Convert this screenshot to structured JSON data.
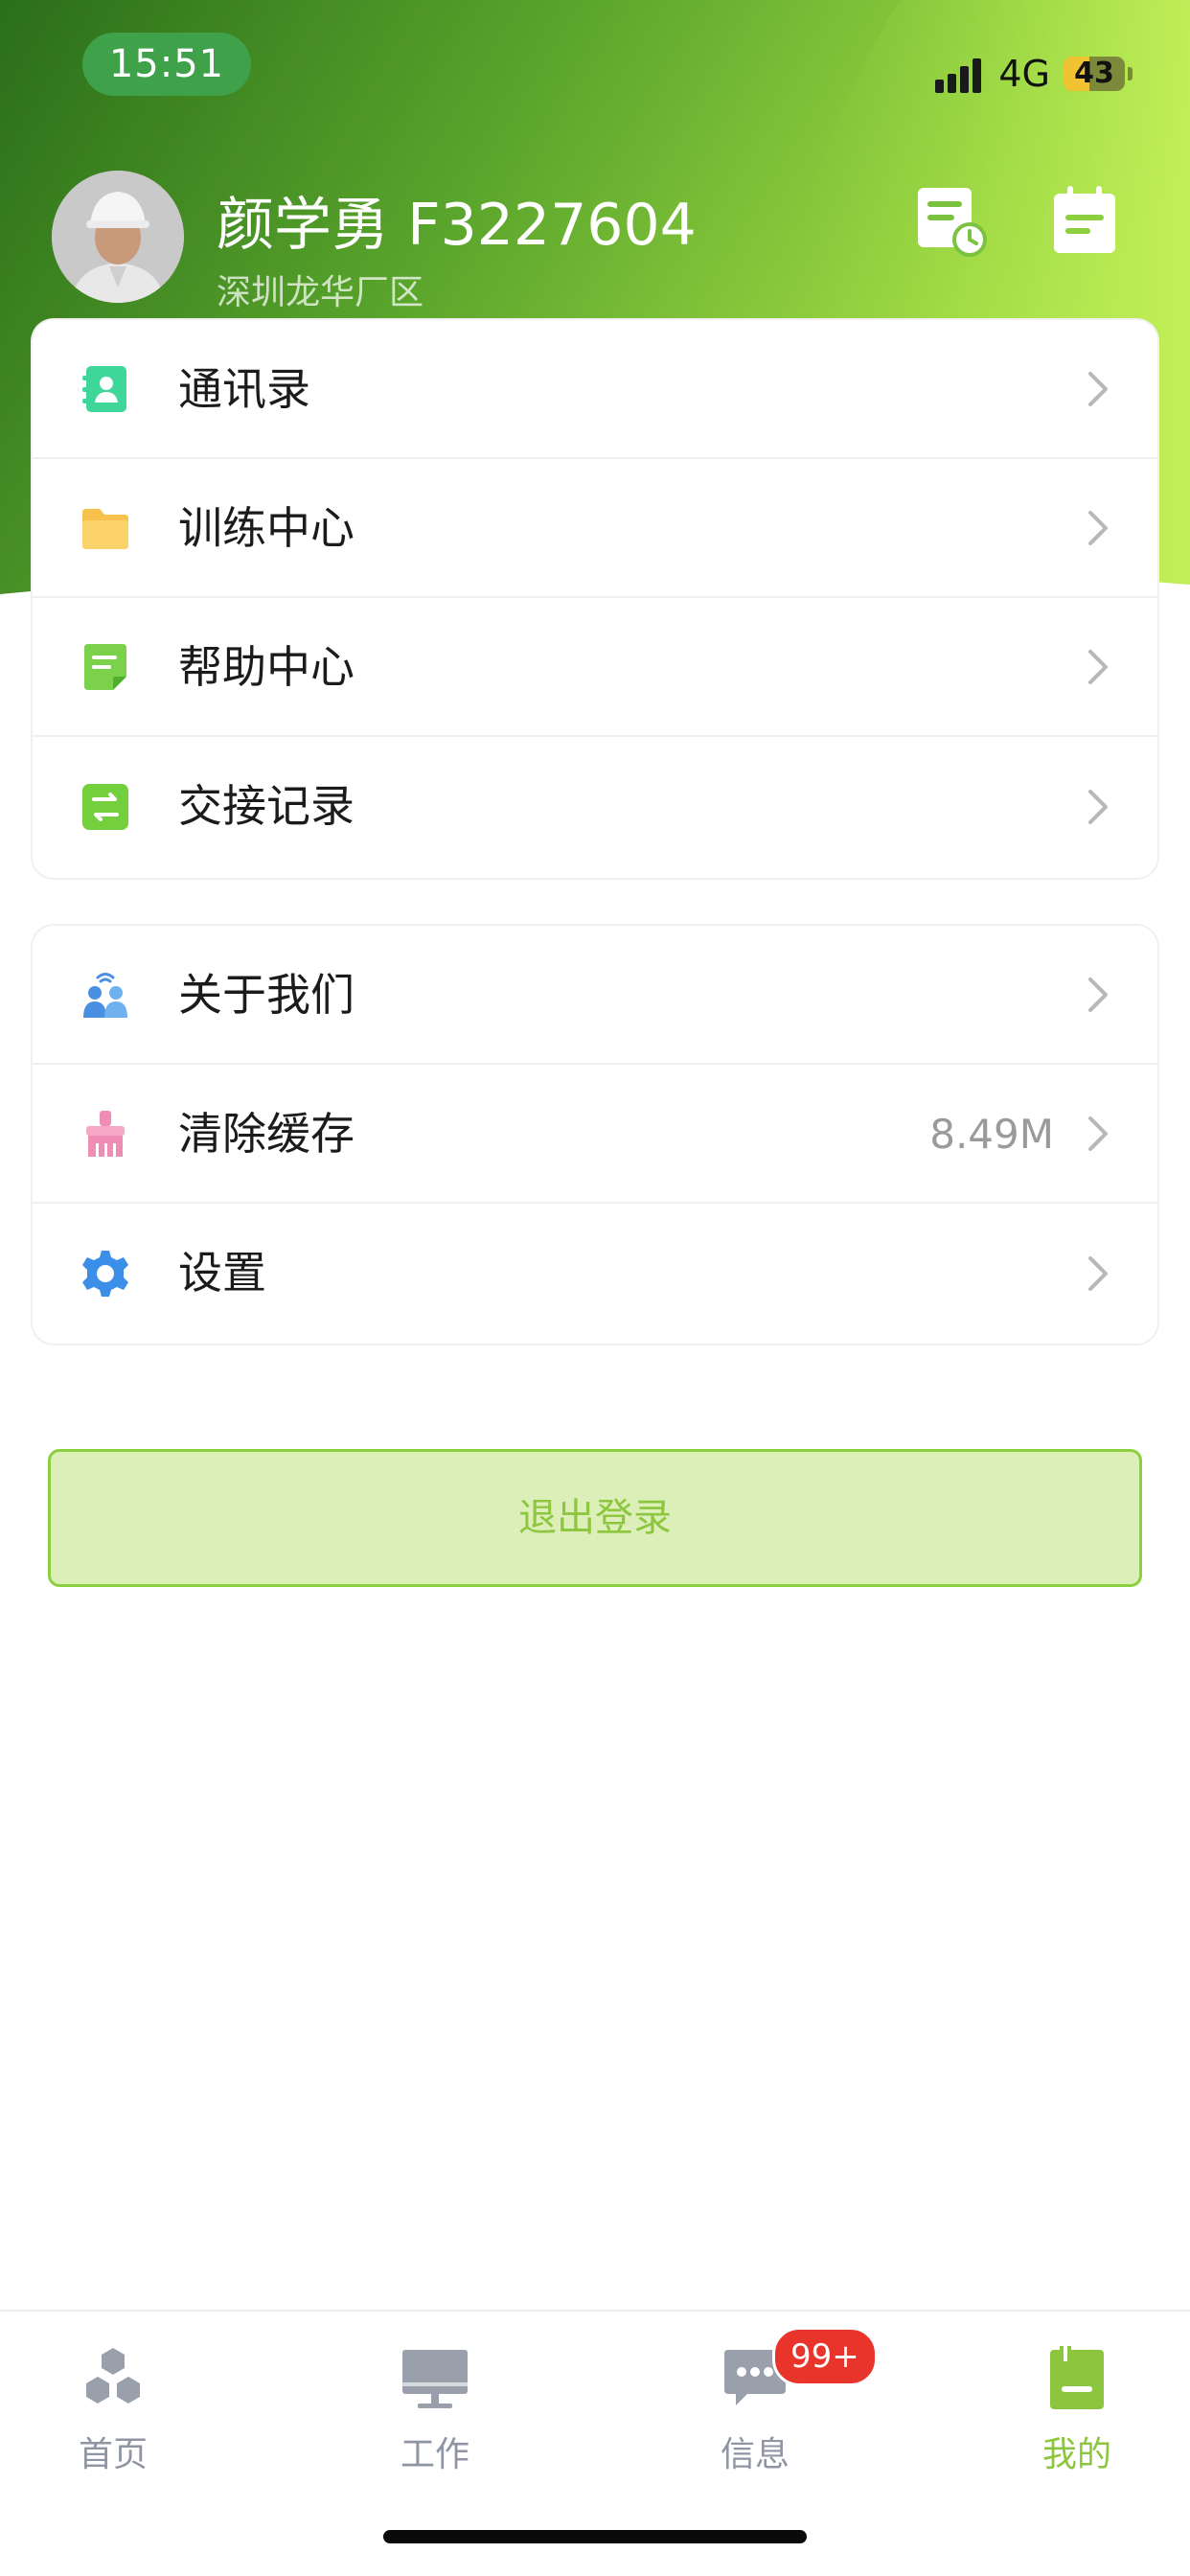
{
  "status_bar": {
    "time": "15:51",
    "network": "4G",
    "battery": "43",
    "battery_level": 0.43
  },
  "profile": {
    "name": "颜学勇 F3227604",
    "site": "深圳龙华厂区",
    "icons": [
      "schedule-doc-icon",
      "task-note-icon"
    ]
  },
  "menu_groups": [
    {
      "items": [
        {
          "label": "通讯录",
          "icon": "contacts-icon",
          "color": "#3fd69a"
        },
        {
          "label": "训练中心",
          "icon": "folder-icon",
          "color": "#f7c24b"
        },
        {
          "label": "帮助中心",
          "icon": "help-doc-icon",
          "color": "#7bd14a"
        },
        {
          "label": "交接记录",
          "icon": "handover-icon",
          "color": "#74cf3d"
        }
      ]
    },
    {
      "items": [
        {
          "label": "关于我们",
          "icon": "about-us-icon",
          "color": "#4a90e2"
        },
        {
          "label": "清除缓存",
          "icon": "brush-icon",
          "color": "#f08db4",
          "value": "8.49M"
        },
        {
          "label": "设置",
          "icon": "gear-icon",
          "color": "#3b8fe8"
        }
      ]
    }
  ],
  "logout": {
    "label": "退出登录"
  },
  "tabs": [
    {
      "label": "首页",
      "icon": "hexagons-icon"
    },
    {
      "label": "工作",
      "icon": "monitor-icon"
    },
    {
      "label": "信息",
      "icon": "chat-bubble-icon",
      "badge": "99+"
    },
    {
      "label": "我的",
      "icon": "profile-doc-icon",
      "active": true
    }
  ],
  "colors": {
    "accent": "#8cc63f",
    "header_dark": "#2e7d1e",
    "header_light": "#b7ea4a",
    "badge": "#e8342a"
  }
}
